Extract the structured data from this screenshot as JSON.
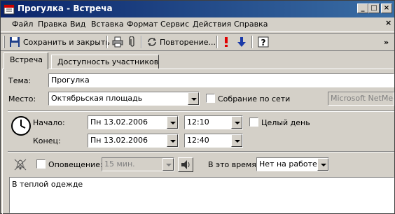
{
  "window": {
    "title": "Прогулка - Встреча"
  },
  "menu": [
    "Файл",
    "Правка",
    "Вид",
    "Вставка",
    "Формат",
    "Сервис",
    "Действия",
    "Справка"
  ],
  "toolbar": {
    "save_close": "Сохранить и закрыть",
    "recurrence": "Повторение...",
    "chevron": "»"
  },
  "tabs": [
    "Встреча",
    "Доступность участников"
  ],
  "form": {
    "subject_label": "Тема:",
    "subject_value": "Прогулка",
    "location_label": "Место:",
    "location_value": "Октябрьская площадь",
    "online_meeting_label": "Собрание по сети",
    "netmeeting_value": "Microsoft NetMeeting",
    "start_label": "Начало:",
    "start_date": "Пн 13.02.2006",
    "start_time": "12:10",
    "allday_label": "Целый день",
    "end_label": "Конец:",
    "end_date": "Пн 13.02.2006",
    "end_time": "12:40",
    "reminder_label": "Оповещение:",
    "reminder_value": "15 мин.",
    "showas_label": "В это время:",
    "showas_value": "Нет на работе",
    "body_text": "В теплой одежде"
  },
  "colors": {
    "titlebar": "#0a246a",
    "face": "#d4d0c8"
  }
}
